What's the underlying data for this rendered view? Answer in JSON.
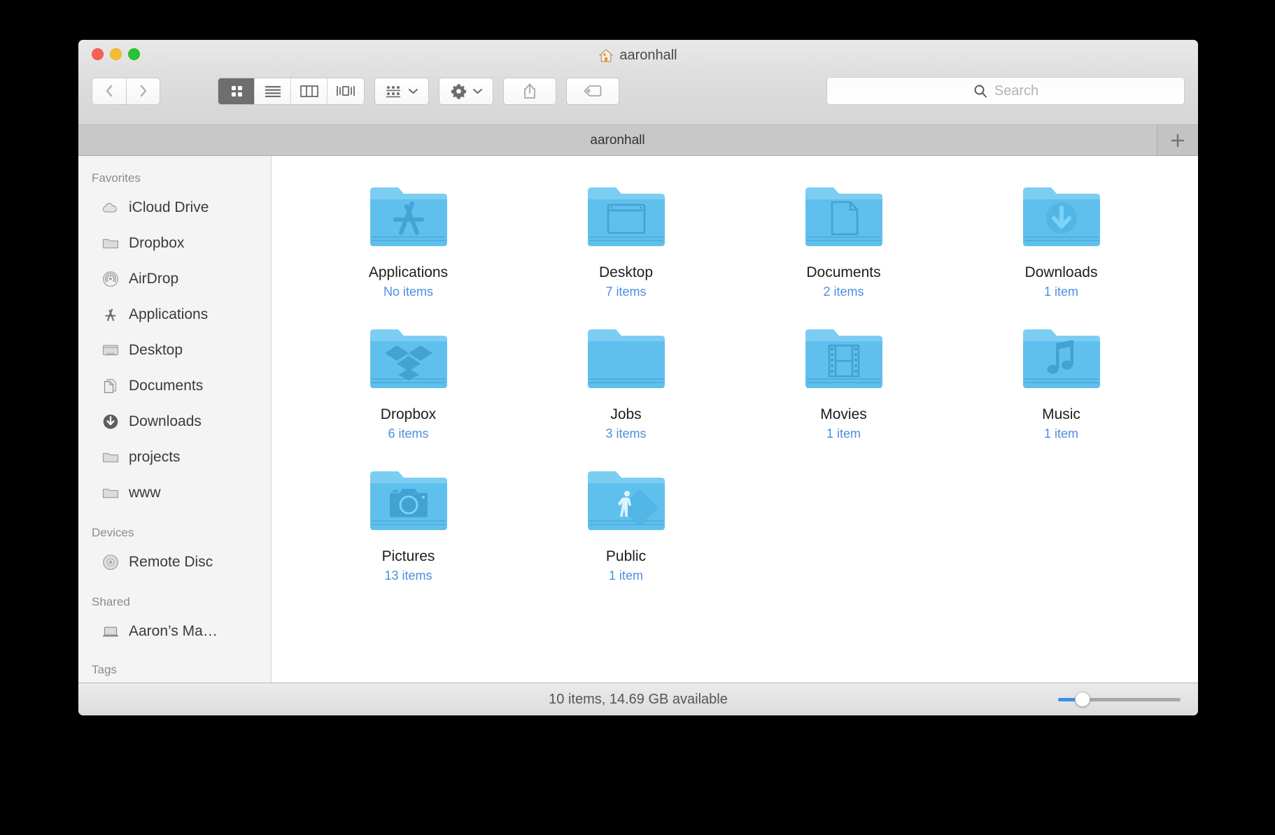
{
  "window": {
    "title": "aaronhall",
    "title_icon": "home-icon",
    "traffic_lights": [
      {
        "name": "close",
        "color": "#fa5e57"
      },
      {
        "name": "minimize",
        "color": "#f6bc2f"
      },
      {
        "name": "zoom",
        "color": "#2ac232"
      }
    ]
  },
  "toolbar": {
    "back_icon": "chevron-left-icon",
    "forward_icon": "chevron-right-icon",
    "view_modes": [
      {
        "name": "icon-view",
        "icon": "grid-icon",
        "active": true
      },
      {
        "name": "list-view",
        "icon": "list-icon",
        "active": false
      },
      {
        "name": "column-view",
        "icon": "columns-icon",
        "active": false
      },
      {
        "name": "coverflow-view",
        "icon": "coverflow-icon",
        "active": false
      }
    ],
    "arrange_icon": "arrange-grid-icon",
    "action_icon": "gear-icon",
    "share_icon": "share-icon",
    "tag_icon": "tag-icon",
    "dropdown_icon": "chevron-down-icon"
  },
  "search": {
    "placeholder": "Search",
    "value": "",
    "icon": "search-icon"
  },
  "tabs": {
    "items": [
      {
        "label": "aaronhall",
        "active": true
      }
    ],
    "add_label": "+",
    "add_icon": "plus-icon"
  },
  "sidebar": {
    "sections": [
      {
        "header": "Favorites",
        "items": [
          {
            "label": "iCloud Drive",
            "icon": "cloud-icon"
          },
          {
            "label": "Dropbox",
            "icon": "folder-icon"
          },
          {
            "label": "AirDrop",
            "icon": "airdrop-icon"
          },
          {
            "label": "Applications",
            "icon": "applications-icon"
          },
          {
            "label": "Desktop",
            "icon": "desktop-icon"
          },
          {
            "label": "Documents",
            "icon": "documents-icon"
          },
          {
            "label": "Downloads",
            "icon": "downloads-icon"
          },
          {
            "label": "projects",
            "icon": "folder-icon"
          },
          {
            "label": "www",
            "icon": "folder-icon"
          }
        ]
      },
      {
        "header": "Devices",
        "items": [
          {
            "label": "Remote Disc",
            "icon": "disc-icon"
          }
        ]
      },
      {
        "header": "Shared",
        "items": [
          {
            "label": "Aaron’s Ma…",
            "icon": "laptop-icon"
          }
        ]
      },
      {
        "header": "Tags",
        "items": []
      }
    ]
  },
  "content": {
    "folders": [
      {
        "name": "Applications",
        "count": "No items",
        "icon": "folder-applications-icon"
      },
      {
        "name": "Desktop",
        "count": "7 items",
        "icon": "folder-desktop-icon"
      },
      {
        "name": "Documents",
        "count": "2 items",
        "icon": "folder-documents-icon"
      },
      {
        "name": "Downloads",
        "count": "1 item",
        "icon": "folder-downloads-icon"
      },
      {
        "name": "Dropbox",
        "count": "6 items",
        "icon": "folder-dropbox-icon"
      },
      {
        "name": "Jobs",
        "count": "3 items",
        "icon": "folder-plain-icon"
      },
      {
        "name": "Movies",
        "count": "1 item",
        "icon": "folder-movies-icon"
      },
      {
        "name": "Music",
        "count": "1 item",
        "icon": "folder-music-icon"
      },
      {
        "name": "Pictures",
        "count": "13 items",
        "icon": "folder-pictures-icon"
      },
      {
        "name": "Public",
        "count": "1 item",
        "icon": "folder-public-icon"
      }
    ]
  },
  "statusbar": {
    "text": "10 items, 14.69 GB available",
    "zoom_percent": 20
  },
  "colors": {
    "folder_blue": "#6ec5f0",
    "accent_blue": "#4c8fe0",
    "slider_blue": "#3b8fef",
    "home_orange": "#e8911e"
  }
}
